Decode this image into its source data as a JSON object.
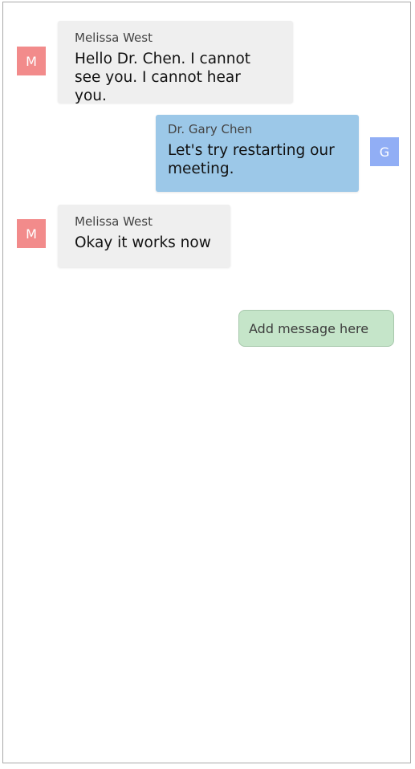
{
  "colors": {
    "incoming_avatar": "#f28b8b",
    "outgoing_avatar": "#91aef5",
    "incoming_bubble": "#efefef",
    "outgoing_bubble": "#9cc8e8",
    "composer_bg": "#c5e5c9"
  },
  "messages": [
    {
      "direction": "incoming",
      "avatar_initial": "M",
      "sender": "Melissa West",
      "text": "Hello Dr. Chen. I cannot see you. I cannot hear you."
    },
    {
      "direction": "outgoing",
      "avatar_initial": "G",
      "sender": "Dr. Gary Chen",
      "text": "Let's try restarting our meeting."
    },
    {
      "direction": "incoming",
      "avatar_initial": "M",
      "sender": "Melissa West",
      "text": "Okay it works now"
    }
  ],
  "composer": {
    "placeholder": "Add message here"
  }
}
